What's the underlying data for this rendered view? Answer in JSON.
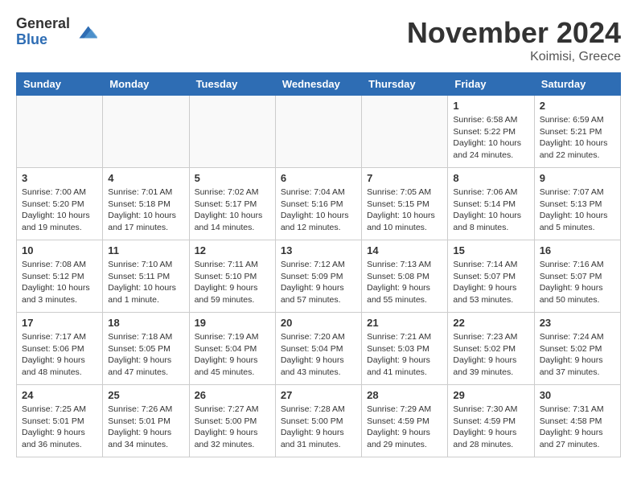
{
  "logo": {
    "general": "General",
    "blue": "Blue"
  },
  "header": {
    "month": "November 2024",
    "location": "Koimisi, Greece"
  },
  "weekdays": [
    "Sunday",
    "Monday",
    "Tuesday",
    "Wednesday",
    "Thursday",
    "Friday",
    "Saturday"
  ],
  "weeks": [
    [
      {
        "day": "",
        "info": ""
      },
      {
        "day": "",
        "info": ""
      },
      {
        "day": "",
        "info": ""
      },
      {
        "day": "",
        "info": ""
      },
      {
        "day": "",
        "info": ""
      },
      {
        "day": "1",
        "info": "Sunrise: 6:58 AM\nSunset: 5:22 PM\nDaylight: 10 hours\nand 24 minutes."
      },
      {
        "day": "2",
        "info": "Sunrise: 6:59 AM\nSunset: 5:21 PM\nDaylight: 10 hours\nand 22 minutes."
      }
    ],
    [
      {
        "day": "3",
        "info": "Sunrise: 7:00 AM\nSunset: 5:20 PM\nDaylight: 10 hours\nand 19 minutes."
      },
      {
        "day": "4",
        "info": "Sunrise: 7:01 AM\nSunset: 5:18 PM\nDaylight: 10 hours\nand 17 minutes."
      },
      {
        "day": "5",
        "info": "Sunrise: 7:02 AM\nSunset: 5:17 PM\nDaylight: 10 hours\nand 14 minutes."
      },
      {
        "day": "6",
        "info": "Sunrise: 7:04 AM\nSunset: 5:16 PM\nDaylight: 10 hours\nand 12 minutes."
      },
      {
        "day": "7",
        "info": "Sunrise: 7:05 AM\nSunset: 5:15 PM\nDaylight: 10 hours\nand 10 minutes."
      },
      {
        "day": "8",
        "info": "Sunrise: 7:06 AM\nSunset: 5:14 PM\nDaylight: 10 hours\nand 8 minutes."
      },
      {
        "day": "9",
        "info": "Sunrise: 7:07 AM\nSunset: 5:13 PM\nDaylight: 10 hours\nand 5 minutes."
      }
    ],
    [
      {
        "day": "10",
        "info": "Sunrise: 7:08 AM\nSunset: 5:12 PM\nDaylight: 10 hours\nand 3 minutes."
      },
      {
        "day": "11",
        "info": "Sunrise: 7:10 AM\nSunset: 5:11 PM\nDaylight: 10 hours\nand 1 minute."
      },
      {
        "day": "12",
        "info": "Sunrise: 7:11 AM\nSunset: 5:10 PM\nDaylight: 9 hours\nand 59 minutes."
      },
      {
        "day": "13",
        "info": "Sunrise: 7:12 AM\nSunset: 5:09 PM\nDaylight: 9 hours\nand 57 minutes."
      },
      {
        "day": "14",
        "info": "Sunrise: 7:13 AM\nSunset: 5:08 PM\nDaylight: 9 hours\nand 55 minutes."
      },
      {
        "day": "15",
        "info": "Sunrise: 7:14 AM\nSunset: 5:07 PM\nDaylight: 9 hours\nand 53 minutes."
      },
      {
        "day": "16",
        "info": "Sunrise: 7:16 AM\nSunset: 5:07 PM\nDaylight: 9 hours\nand 50 minutes."
      }
    ],
    [
      {
        "day": "17",
        "info": "Sunrise: 7:17 AM\nSunset: 5:06 PM\nDaylight: 9 hours\nand 48 minutes."
      },
      {
        "day": "18",
        "info": "Sunrise: 7:18 AM\nSunset: 5:05 PM\nDaylight: 9 hours\nand 47 minutes."
      },
      {
        "day": "19",
        "info": "Sunrise: 7:19 AM\nSunset: 5:04 PM\nDaylight: 9 hours\nand 45 minutes."
      },
      {
        "day": "20",
        "info": "Sunrise: 7:20 AM\nSunset: 5:04 PM\nDaylight: 9 hours\nand 43 minutes."
      },
      {
        "day": "21",
        "info": "Sunrise: 7:21 AM\nSunset: 5:03 PM\nDaylight: 9 hours\nand 41 minutes."
      },
      {
        "day": "22",
        "info": "Sunrise: 7:23 AM\nSunset: 5:02 PM\nDaylight: 9 hours\nand 39 minutes."
      },
      {
        "day": "23",
        "info": "Sunrise: 7:24 AM\nSunset: 5:02 PM\nDaylight: 9 hours\nand 37 minutes."
      }
    ],
    [
      {
        "day": "24",
        "info": "Sunrise: 7:25 AM\nSunset: 5:01 PM\nDaylight: 9 hours\nand 36 minutes."
      },
      {
        "day": "25",
        "info": "Sunrise: 7:26 AM\nSunset: 5:01 PM\nDaylight: 9 hours\nand 34 minutes."
      },
      {
        "day": "26",
        "info": "Sunrise: 7:27 AM\nSunset: 5:00 PM\nDaylight: 9 hours\nand 32 minutes."
      },
      {
        "day": "27",
        "info": "Sunrise: 7:28 AM\nSunset: 5:00 PM\nDaylight: 9 hours\nand 31 minutes."
      },
      {
        "day": "28",
        "info": "Sunrise: 7:29 AM\nSunset: 4:59 PM\nDaylight: 9 hours\nand 29 minutes."
      },
      {
        "day": "29",
        "info": "Sunrise: 7:30 AM\nSunset: 4:59 PM\nDaylight: 9 hours\nand 28 minutes."
      },
      {
        "day": "30",
        "info": "Sunrise: 7:31 AM\nSunset: 4:58 PM\nDaylight: 9 hours\nand 27 minutes."
      }
    ]
  ]
}
